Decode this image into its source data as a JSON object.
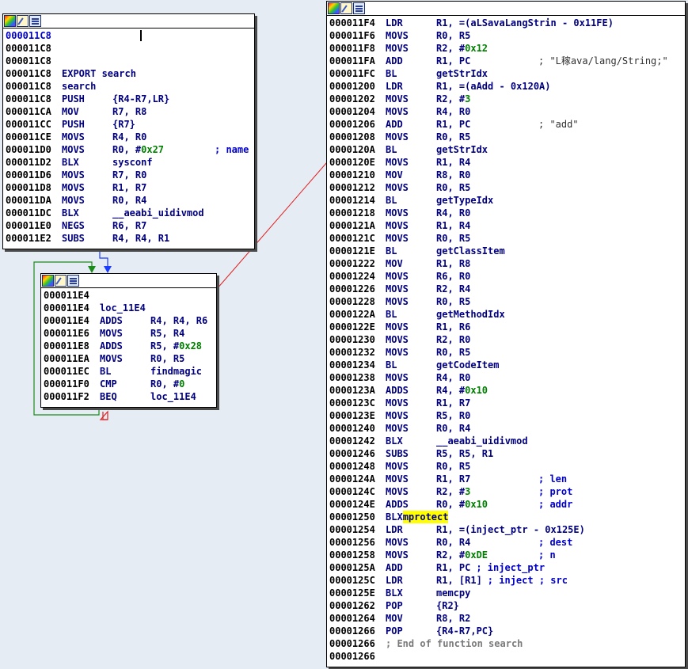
{
  "blocks": {
    "a": {
      "lines": [
        {
          "addr": "000011C8",
          "mn": "",
          "ops": ""
        },
        {
          "addr": "000011C8",
          "mn": "",
          "ops": ""
        },
        {
          "addr": "000011C8",
          "mn": "",
          "ops": ""
        },
        {
          "addr": "000011C8",
          "mn": "EXPORT search",
          "ops": ""
        },
        {
          "addr": "000011C8",
          "mn": "search",
          "ops": ""
        },
        {
          "addr": "000011C8",
          "mn": "PUSH",
          "ops": "{R4-R7,LR}"
        },
        {
          "addr": "000011CA",
          "mn": "MOV",
          "ops": "R7, R8"
        },
        {
          "addr": "000011CC",
          "mn": "PUSH",
          "ops": "{R7}"
        },
        {
          "addr": "000011CE",
          "mn": "MOVS",
          "ops": "R4, R0"
        },
        {
          "addr": "000011D0",
          "mn": "MOVS",
          "ops": "R0, #",
          "num": "0x27",
          "cmt": "; name"
        },
        {
          "addr": "000011D2",
          "mn": "BLX",
          "ops": "sysconf"
        },
        {
          "addr": "000011D6",
          "mn": "MOVS",
          "ops": "R7, R0"
        },
        {
          "addr": "000011D8",
          "mn": "MOVS",
          "ops": "R1, R7"
        },
        {
          "addr": "000011DA",
          "mn": "MOVS",
          "ops": "R0, R4"
        },
        {
          "addr": "000011DC",
          "mn": "BLX",
          "ops": "__aeabi_uidivmod"
        },
        {
          "addr": "000011E0",
          "mn": "NEGS",
          "ops": "R6, R7"
        },
        {
          "addr": "000011E2",
          "mn": "SUBS",
          "ops": "R4, R4, R1"
        }
      ]
    },
    "b": {
      "lines": [
        {
          "addr": "000011E4",
          "mn": "",
          "ops": ""
        },
        {
          "addr": "000011E4",
          "mn": "loc_11E4",
          "ops": ""
        },
        {
          "addr": "000011E4",
          "mn": "ADDS",
          "ops": "R4, R4, R6"
        },
        {
          "addr": "000011E6",
          "mn": "MOVS",
          "ops": "R5, R4"
        },
        {
          "addr": "000011E8",
          "mn": "ADDS",
          "ops": "R5, #",
          "num": "0x28"
        },
        {
          "addr": "000011EA",
          "mn": "MOVS",
          "ops": "R0, R5"
        },
        {
          "addr": "000011EC",
          "mn": "BL",
          "ops": "findmagic"
        },
        {
          "addr": "000011F0",
          "mn": "CMP",
          "ops": "R0, #",
          "num": "0"
        },
        {
          "addr": "000011F2",
          "mn": "BEQ",
          "ops": "loc_11E4"
        }
      ]
    },
    "c": {
      "lines": [
        {
          "addr": "000011F4",
          "mn": "LDR",
          "ops": "R1, =(aLSavaLangStrin - 0x11FE)"
        },
        {
          "addr": "000011F6",
          "mn": "MOVS",
          "ops": "R0, R5"
        },
        {
          "addr": "000011F8",
          "mn": "MOVS",
          "ops": "R2, #",
          "num": "0x12"
        },
        {
          "addr": "000011FA",
          "mn": "ADD",
          "ops": "R1, PC",
          "str": "; \"L稼ava/lang/String;\""
        },
        {
          "addr": "000011FC",
          "mn": "BL",
          "ops": "getStrIdx"
        },
        {
          "addr": "00001200",
          "mn": "LDR",
          "ops": "R1, =(aAdd - 0x120A)"
        },
        {
          "addr": "00001202",
          "mn": "MOVS",
          "ops": "R2, #",
          "num": "3"
        },
        {
          "addr": "00001204",
          "mn": "MOVS",
          "ops": "R4, R0"
        },
        {
          "addr": "00001206",
          "mn": "ADD",
          "ops": "R1, PC",
          "str": "; \"add\""
        },
        {
          "addr": "00001208",
          "mn": "MOVS",
          "ops": "R0, R5"
        },
        {
          "addr": "0000120A",
          "mn": "BL",
          "ops": "getStrIdx"
        },
        {
          "addr": "0000120E",
          "mn": "MOVS",
          "ops": "R1, R4"
        },
        {
          "addr": "00001210",
          "mn": "MOV",
          "ops": "R8, R0"
        },
        {
          "addr": "00001212",
          "mn": "MOVS",
          "ops": "R0, R5"
        },
        {
          "addr": "00001214",
          "mn": "BL",
          "ops": "getTypeIdx"
        },
        {
          "addr": "00001218",
          "mn": "MOVS",
          "ops": "R4, R0"
        },
        {
          "addr": "0000121A",
          "mn": "MOVS",
          "ops": "R1, R4"
        },
        {
          "addr": "0000121C",
          "mn": "MOVS",
          "ops": "R0, R5"
        },
        {
          "addr": "0000121E",
          "mn": "BL",
          "ops": "getClassItem"
        },
        {
          "addr": "00001222",
          "mn": "MOV",
          "ops": "R1, R8"
        },
        {
          "addr": "00001224",
          "mn": "MOVS",
          "ops": "R6, R0"
        },
        {
          "addr": "00001226",
          "mn": "MOVS",
          "ops": "R2, R4"
        },
        {
          "addr": "00001228",
          "mn": "MOVS",
          "ops": "R0, R5"
        },
        {
          "addr": "0000122A",
          "mn": "BL",
          "ops": "getMethodIdx"
        },
        {
          "addr": "0000122E",
          "mn": "MOVS",
          "ops": "R1, R6"
        },
        {
          "addr": "00001230",
          "mn": "MOVS",
          "ops": "R2, R0"
        },
        {
          "addr": "00001232",
          "mn": "MOVS",
          "ops": "R0, R5"
        },
        {
          "addr": "00001234",
          "mn": "BL",
          "ops": "getCodeItem"
        },
        {
          "addr": "00001238",
          "mn": "MOVS",
          "ops": "R4, R0"
        },
        {
          "addr": "0000123A",
          "mn": "ADDS",
          "ops": "R4, #",
          "num": "0x10"
        },
        {
          "addr": "0000123C",
          "mn": "MOVS",
          "ops": "R1, R7"
        },
        {
          "addr": "0000123E",
          "mn": "MOVS",
          "ops": "R5, R0"
        },
        {
          "addr": "00001240",
          "mn": "MOVS",
          "ops": "R0, R4"
        },
        {
          "addr": "00001242",
          "mn": "BLX",
          "ops": "__aeabi_uidivmod"
        },
        {
          "addr": "00001246",
          "mn": "SUBS",
          "ops": "R5, R5, R1"
        },
        {
          "addr": "00001248",
          "mn": "MOVS",
          "ops": "R0, R5"
        },
        {
          "addr": "0000124A",
          "mn": "MOVS",
          "ops": "R1, R7",
          "cmt": "; len"
        },
        {
          "addr": "0000124C",
          "mn": "MOVS",
          "ops": "R2, #",
          "num": "3",
          "cmt": "; prot"
        },
        {
          "addr": "0000124E",
          "mn": "ADDS",
          "ops": "R0, #",
          "num": "0x10",
          "cmt": "; addr"
        },
        {
          "addr": "00001250",
          "mn": "BLX",
          "ops": "",
          "hl": "mprotect"
        },
        {
          "addr": "00001254",
          "mn": "LDR",
          "ops": "R1, =(inject_ptr - 0x125E)"
        },
        {
          "addr": "00001256",
          "mn": "MOVS",
          "ops": "R0, R4",
          "cmt": "; dest"
        },
        {
          "addr": "00001258",
          "mn": "MOVS",
          "ops": "R2, #",
          "num": "0xDE",
          "cmt": "; n"
        },
        {
          "addr": "0000125A",
          "mn": "ADD",
          "ops": "R1, PC",
          "cmt": "; inject_ptr"
        },
        {
          "addr": "0000125C",
          "mn": "LDR",
          "ops": "R1, [R1]",
          "cmt": "; inject ; src"
        },
        {
          "addr": "0000125E",
          "mn": "BLX",
          "ops": "memcpy"
        },
        {
          "addr": "00001262",
          "mn": "POP",
          "ops": "{R2}"
        },
        {
          "addr": "00001264",
          "mn": "MOV",
          "ops": "R8, R2"
        },
        {
          "addr": "00001266",
          "mn": "POP",
          "ops": "{R4-R7,PC}"
        },
        {
          "addr": "00001266",
          "mn": "",
          "ops": "",
          "gray": "; End of function search"
        },
        {
          "addr": "00001266",
          "mn": "",
          "ops": ""
        }
      ]
    }
  },
  "colors": {
    "edge_true": "#1a8a1a",
    "edge_next": "#1a3cff",
    "edge_false": "#e02020",
    "highlight": "#ffff00"
  },
  "icons": [
    "color-palette-icon",
    "edit-icon",
    "graph-overview-icon"
  ]
}
